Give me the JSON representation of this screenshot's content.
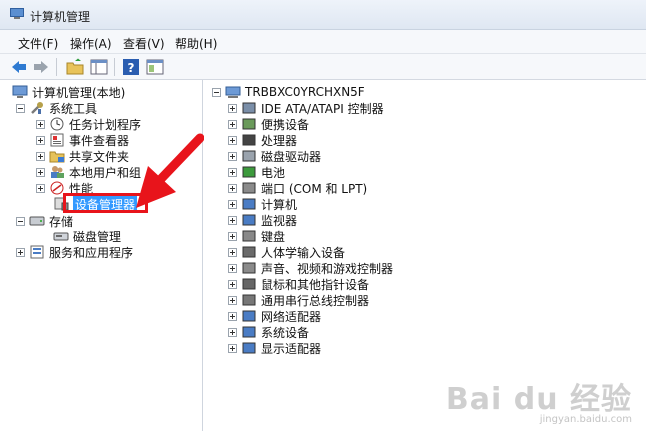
{
  "window": {
    "title": "计算机管理"
  },
  "menubar": [
    {
      "label": "文件(F)"
    },
    {
      "label": "操作(A)"
    },
    {
      "label": "查看(V)"
    },
    {
      "label": "帮助(H)"
    }
  ],
  "toolbar": {
    "icons": [
      "back-arrow-icon",
      "forward-arrow-icon",
      "up-folder-icon",
      "show-hide-tree-icon",
      "help-icon",
      "properties-icon"
    ]
  },
  "left_tree": {
    "root": "计算机管理(本地)",
    "system_tools": "系统工具",
    "task_scheduler": "任务计划程序",
    "event_viewer": "事件查看器",
    "shared_folders": "共享文件夹",
    "local_users": "本地用户和组",
    "performance": "性能",
    "device_manager": "设备管理器",
    "storage": "存储",
    "disk_management": "磁盘管理",
    "services_apps": "服务和应用程序"
  },
  "right_tree": {
    "computer_name": "TRBBXC0YRCHXN5F",
    "items": [
      {
        "label": "IDE ATA/ATAPI 控制器",
        "icon": "ide-controller-icon"
      },
      {
        "label": "便携设备",
        "icon": "portable-device-icon"
      },
      {
        "label": "处理器",
        "icon": "processor-icon"
      },
      {
        "label": "磁盘驱动器",
        "icon": "disk-drive-icon"
      },
      {
        "label": "电池",
        "icon": "battery-icon"
      },
      {
        "label": "端口 (COM 和 LPT)",
        "icon": "port-icon"
      },
      {
        "label": "计算机",
        "icon": "computer-icon"
      },
      {
        "label": "监视器",
        "icon": "monitor-icon"
      },
      {
        "label": "键盘",
        "icon": "keyboard-icon"
      },
      {
        "label": "人体学输入设备",
        "icon": "hid-icon"
      },
      {
        "label": "声音、视频和游戏控制器",
        "icon": "sound-icon"
      },
      {
        "label": "鼠标和其他指针设备",
        "icon": "mouse-icon"
      },
      {
        "label": "通用串行总线控制器",
        "icon": "usb-icon"
      },
      {
        "label": "网络适配器",
        "icon": "network-adapter-icon"
      },
      {
        "label": "系统设备",
        "icon": "system-device-icon"
      },
      {
        "label": "显示适配器",
        "icon": "display-adapter-icon"
      }
    ]
  },
  "watermark": {
    "logo": "Bai du 经验",
    "url": "jingyan.baidu.com"
  },
  "colors": {
    "highlight_border": "#e8141b",
    "arrow": "#e8141b",
    "selection": "#3399ff"
  }
}
